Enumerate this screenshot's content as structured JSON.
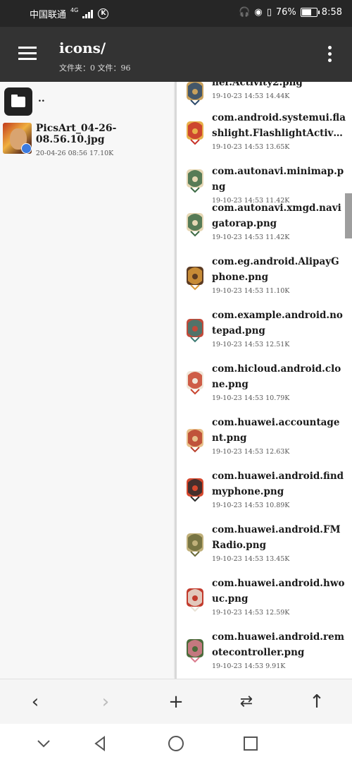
{
  "status": {
    "carrier": "中国联通",
    "network": "4G",
    "battery": "76%",
    "battery_level": 0.76,
    "time": "8:58"
  },
  "appbar": {
    "title": "icons/",
    "subtitle": "文件夹：0  文件：96"
  },
  "left_pane": {
    "parent_label": "..",
    "file": {
      "name": "PicsArt_04-26-08.56.10.jpg",
      "meta": "20-04-26 08:56  17.10K"
    }
  },
  "right_pane": {
    "items": [
      {
        "name": "ner.Activity2.png",
        "meta": "19-10-23 14:53  14.44K",
        "icon": "ribbon-icon"
      },
      {
        "name": "com.android.systemui.flashlight.FlashlightActiv…",
        "meta": "19-10-23 14:53  13.65K",
        "icon": "lantern-icon"
      },
      {
        "name": "com.autonavi.minimap.png",
        "meta": "19-10-23 14:53  11.42K",
        "icon": "map-scroll-icon"
      },
      {
        "name": "com.autonavi.xmgd.navigatorap.png",
        "meta": "19-10-23 14:53  11.42K",
        "icon": "map-scroll-icon"
      },
      {
        "name": "com.eg.android.AlipayGphone.png",
        "meta": "19-10-23 14:53  11.10K",
        "icon": "bowl-icon"
      },
      {
        "name": "com.example.android.notepad.png",
        "meta": "19-10-23 14:53  12.51K",
        "icon": "notebook-icon"
      },
      {
        "name": "com.hicloud.android.clone.png",
        "meta": "19-10-23 14:53  10.79K",
        "icon": "koi-icon"
      },
      {
        "name": "com.huawei.accountagent.png",
        "meta": "19-10-23 14:53  12.63K",
        "icon": "gate-icon"
      },
      {
        "name": "com.huawei.android.findmyphone.png",
        "meta": "19-10-23 14:53  10.89K",
        "icon": "phone-lantern-icon"
      },
      {
        "name": "com.huawei.android.FMRadio.png",
        "meta": "19-10-23 14:53  13.45K",
        "icon": "bell-icon"
      },
      {
        "name": "com.huawei.android.hwouc.png",
        "meta": "19-10-23 14:53  12.59K",
        "icon": "crane-icon"
      },
      {
        "name": "com.huawei.android.remotecontroller.png",
        "meta": "19-10-23 14:53  9.91K",
        "icon": "flower-branch-icon"
      }
    ]
  },
  "actions": {
    "back": "‹",
    "forward": "›",
    "add": "+",
    "swap": "⇄",
    "up": "↑"
  }
}
